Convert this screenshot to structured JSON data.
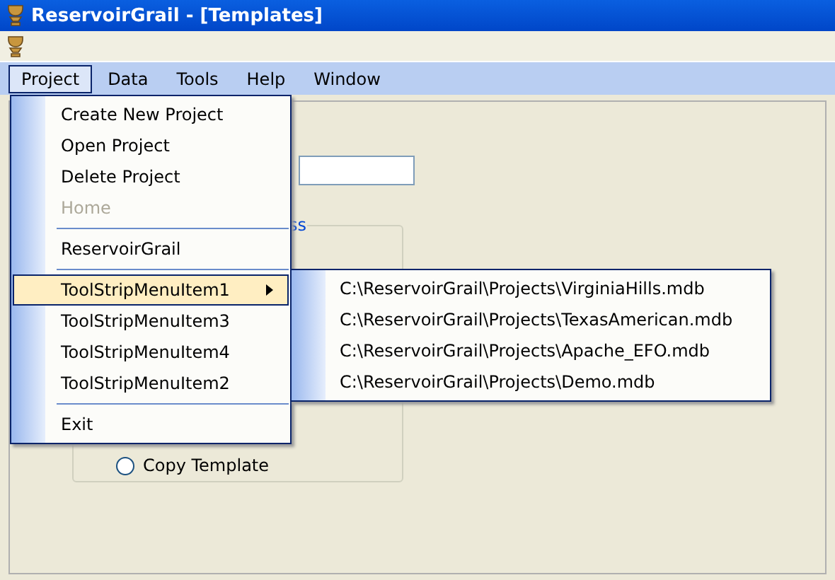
{
  "window": {
    "title": "ReservoirGrail - [Templates]"
  },
  "menubar": [
    {
      "label": "Project",
      "selected": true
    },
    {
      "label": "Data",
      "selected": false
    },
    {
      "label": "Tools",
      "selected": false
    },
    {
      "label": "Help",
      "selected": false
    },
    {
      "label": "Window",
      "selected": false
    }
  ],
  "project_menu": [
    {
      "kind": "item",
      "label": "Create New Project",
      "disabled": false,
      "selected": false
    },
    {
      "kind": "item",
      "label": "Open Project",
      "disabled": false,
      "selected": false
    },
    {
      "kind": "item",
      "label": "Delete Project",
      "disabled": false,
      "selected": false
    },
    {
      "kind": "item",
      "label": "Home",
      "disabled": true,
      "selected": false
    },
    {
      "kind": "separator"
    },
    {
      "kind": "item",
      "label": "ReservoirGrail",
      "disabled": false,
      "selected": false
    },
    {
      "kind": "separator"
    },
    {
      "kind": "submenu",
      "label": "ToolStripMenuItem1",
      "disabled": false,
      "selected": true
    },
    {
      "kind": "item",
      "label": "ToolStripMenuItem3",
      "disabled": false,
      "selected": false
    },
    {
      "kind": "item",
      "label": "ToolStripMenuItem4",
      "disabled": false,
      "selected": false
    },
    {
      "kind": "item",
      "label": "ToolStripMenuItem2",
      "disabled": false,
      "selected": false
    },
    {
      "kind": "separator"
    },
    {
      "kind": "item",
      "label": "Exit",
      "disabled": false,
      "selected": false
    }
  ],
  "submenu": [
    "C:\\ReservoirGrail\\Projects\\VirginiaHills.mdb",
    "C:\\ReservoirGrail\\Projects\\TexasAmerican.mdb",
    "C:\\ReservoirGrail\\Projects\\Apache_EFO.mdb",
    "C:\\ReservoirGrail\\Projects\\Demo.mdb"
  ],
  "form": {
    "group_title": "ss",
    "radio_label": "Copy Template",
    "radio_checked": false
  }
}
